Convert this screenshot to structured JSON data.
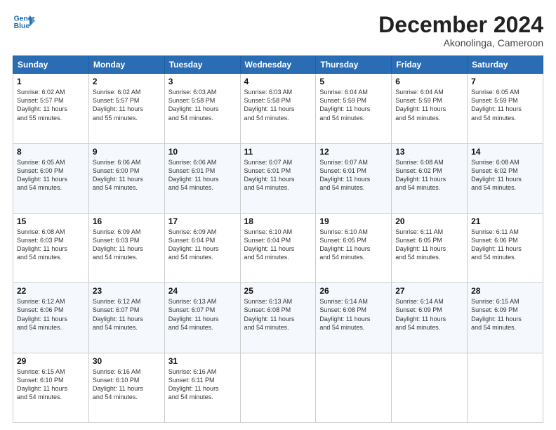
{
  "header": {
    "logo_line1": "General",
    "logo_line2": "Blue",
    "month": "December 2024",
    "location": "Akonolinga, Cameroon"
  },
  "weekdays": [
    "Sunday",
    "Monday",
    "Tuesday",
    "Wednesday",
    "Thursday",
    "Friday",
    "Saturday"
  ],
  "weeks": [
    [
      {
        "day": "1",
        "info": "Sunrise: 6:02 AM\nSunset: 5:57 PM\nDaylight: 11 hours\nand 55 minutes."
      },
      {
        "day": "2",
        "info": "Sunrise: 6:02 AM\nSunset: 5:57 PM\nDaylight: 11 hours\nand 55 minutes."
      },
      {
        "day": "3",
        "info": "Sunrise: 6:03 AM\nSunset: 5:58 PM\nDaylight: 11 hours\nand 54 minutes."
      },
      {
        "day": "4",
        "info": "Sunrise: 6:03 AM\nSunset: 5:58 PM\nDaylight: 11 hours\nand 54 minutes."
      },
      {
        "day": "5",
        "info": "Sunrise: 6:04 AM\nSunset: 5:59 PM\nDaylight: 11 hours\nand 54 minutes."
      },
      {
        "day": "6",
        "info": "Sunrise: 6:04 AM\nSunset: 5:59 PM\nDaylight: 11 hours\nand 54 minutes."
      },
      {
        "day": "7",
        "info": "Sunrise: 6:05 AM\nSunset: 5:59 PM\nDaylight: 11 hours\nand 54 minutes."
      }
    ],
    [
      {
        "day": "8",
        "info": "Sunrise: 6:05 AM\nSunset: 6:00 PM\nDaylight: 11 hours\nand 54 minutes."
      },
      {
        "day": "9",
        "info": "Sunrise: 6:06 AM\nSunset: 6:00 PM\nDaylight: 11 hours\nand 54 minutes."
      },
      {
        "day": "10",
        "info": "Sunrise: 6:06 AM\nSunset: 6:01 PM\nDaylight: 11 hours\nand 54 minutes."
      },
      {
        "day": "11",
        "info": "Sunrise: 6:07 AM\nSunset: 6:01 PM\nDaylight: 11 hours\nand 54 minutes."
      },
      {
        "day": "12",
        "info": "Sunrise: 6:07 AM\nSunset: 6:01 PM\nDaylight: 11 hours\nand 54 minutes."
      },
      {
        "day": "13",
        "info": "Sunrise: 6:08 AM\nSunset: 6:02 PM\nDaylight: 11 hours\nand 54 minutes."
      },
      {
        "day": "14",
        "info": "Sunrise: 6:08 AM\nSunset: 6:02 PM\nDaylight: 11 hours\nand 54 minutes."
      }
    ],
    [
      {
        "day": "15",
        "info": "Sunrise: 6:08 AM\nSunset: 6:03 PM\nDaylight: 11 hours\nand 54 minutes."
      },
      {
        "day": "16",
        "info": "Sunrise: 6:09 AM\nSunset: 6:03 PM\nDaylight: 11 hours\nand 54 minutes."
      },
      {
        "day": "17",
        "info": "Sunrise: 6:09 AM\nSunset: 6:04 PM\nDaylight: 11 hours\nand 54 minutes."
      },
      {
        "day": "18",
        "info": "Sunrise: 6:10 AM\nSunset: 6:04 PM\nDaylight: 11 hours\nand 54 minutes."
      },
      {
        "day": "19",
        "info": "Sunrise: 6:10 AM\nSunset: 6:05 PM\nDaylight: 11 hours\nand 54 minutes."
      },
      {
        "day": "20",
        "info": "Sunrise: 6:11 AM\nSunset: 6:05 PM\nDaylight: 11 hours\nand 54 minutes."
      },
      {
        "day": "21",
        "info": "Sunrise: 6:11 AM\nSunset: 6:06 PM\nDaylight: 11 hours\nand 54 minutes."
      }
    ],
    [
      {
        "day": "22",
        "info": "Sunrise: 6:12 AM\nSunset: 6:06 PM\nDaylight: 11 hours\nand 54 minutes."
      },
      {
        "day": "23",
        "info": "Sunrise: 6:12 AM\nSunset: 6:07 PM\nDaylight: 11 hours\nand 54 minutes."
      },
      {
        "day": "24",
        "info": "Sunrise: 6:13 AM\nSunset: 6:07 PM\nDaylight: 11 hours\nand 54 minutes."
      },
      {
        "day": "25",
        "info": "Sunrise: 6:13 AM\nSunset: 6:08 PM\nDaylight: 11 hours\nand 54 minutes."
      },
      {
        "day": "26",
        "info": "Sunrise: 6:14 AM\nSunset: 6:08 PM\nDaylight: 11 hours\nand 54 minutes."
      },
      {
        "day": "27",
        "info": "Sunrise: 6:14 AM\nSunset: 6:09 PM\nDaylight: 11 hours\nand 54 minutes."
      },
      {
        "day": "28",
        "info": "Sunrise: 6:15 AM\nSunset: 6:09 PM\nDaylight: 11 hours\nand 54 minutes."
      }
    ],
    [
      {
        "day": "29",
        "info": "Sunrise: 6:15 AM\nSunset: 6:10 PM\nDaylight: 11 hours\nand 54 minutes."
      },
      {
        "day": "30",
        "info": "Sunrise: 6:16 AM\nSunset: 6:10 PM\nDaylight: 11 hours\nand 54 minutes."
      },
      {
        "day": "31",
        "info": "Sunrise: 6:16 AM\nSunset: 6:11 PM\nDaylight: 11 hours\nand 54 minutes."
      },
      {
        "day": "",
        "info": ""
      },
      {
        "day": "",
        "info": ""
      },
      {
        "day": "",
        "info": ""
      },
      {
        "day": "",
        "info": ""
      }
    ]
  ]
}
